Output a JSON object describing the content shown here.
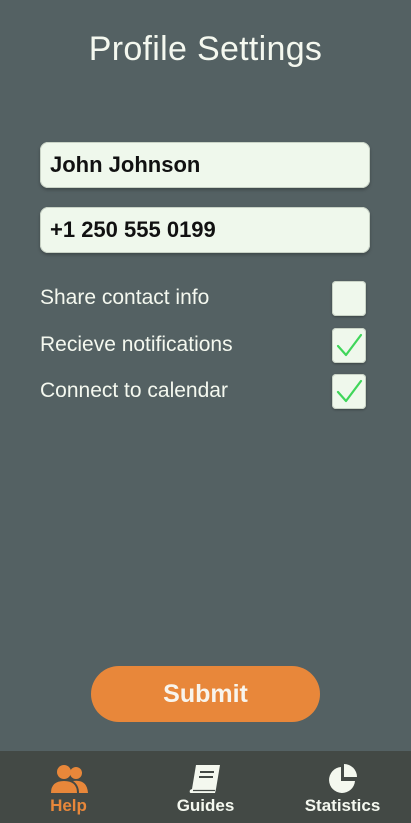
{
  "header": {
    "title": "Profile Settings"
  },
  "form": {
    "name_value": "John Johnson",
    "phone_value": "+1 250 555 0199",
    "options": [
      {
        "label": "Share contact info",
        "checked": false
      },
      {
        "label": "Recieve notifications",
        "checked": true
      },
      {
        "label": "Connect to calendar",
        "checked": true
      }
    ],
    "submit_label": "Submit"
  },
  "nav": {
    "items": [
      {
        "label": "Help",
        "icon": "users-icon",
        "active": true
      },
      {
        "label": "Guides",
        "icon": "book-icon",
        "active": false
      },
      {
        "label": "Statistics",
        "icon": "pie-chart-icon",
        "active": false
      }
    ]
  },
  "colors": {
    "background": "#546163",
    "field": "#eff8ec",
    "accent": "#e8873a",
    "check": "#3fd65a",
    "navbar": "#434945"
  }
}
